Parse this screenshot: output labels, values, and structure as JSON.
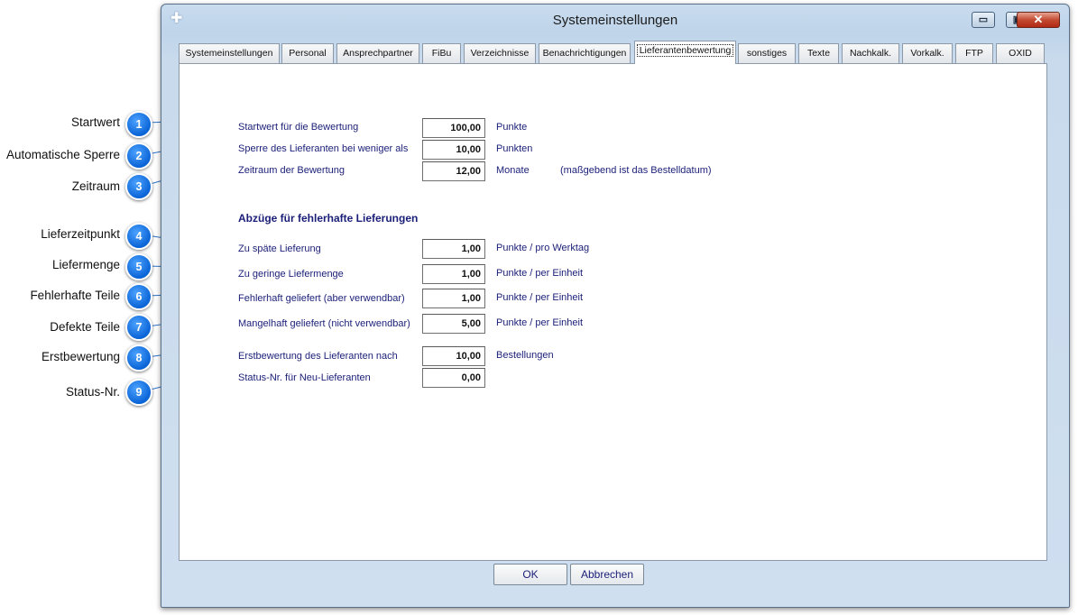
{
  "window": {
    "title": "Systemeinstellungen",
    "min_glyph": "▭",
    "max_glyph": "▣",
    "close_glyph": "✕"
  },
  "tabs": [
    {
      "label": "Systemeinstellungen"
    },
    {
      "label": "Personal"
    },
    {
      "label": "Ansprechpartner"
    },
    {
      "label": "FiBu"
    },
    {
      "label": "Verzeichnisse"
    },
    {
      "label": "Benachrichtigungen"
    },
    {
      "label": "Lieferantenbewertung",
      "active": true
    },
    {
      "label": "sonstiges"
    },
    {
      "label": "Texte"
    },
    {
      "label": "Nachkalk."
    },
    {
      "label": "Vorkalk."
    },
    {
      "label": "FTP"
    },
    {
      "label": "OXID"
    }
  ],
  "section_heading": "Abzüge für fehlerhafte Lieferungen",
  "rows": [
    {
      "label": "Startwert für die Bewertung",
      "value": "100,00",
      "unit": "Punkte"
    },
    {
      "label": "Sperre des Lieferanten bei weniger als",
      "value": "10,00",
      "unit": "Punkten"
    },
    {
      "label": "Zeitraum der Bewertung",
      "value": "12,00",
      "unit": "Monate",
      "note": "(maßgebend ist das Bestelldatum)"
    },
    {
      "label": "Zu späte Lieferung",
      "value": "1,00",
      "unit": "Punkte / pro Werktag"
    },
    {
      "label": "Zu geringe Liefermenge",
      "value": "1,00",
      "unit": "Punkte / per Einheit"
    },
    {
      "label": "Fehlerhaft geliefert (aber verwendbar)",
      "value": "1,00",
      "unit": "Punkte / per Einheit"
    },
    {
      "label": "Mangelhaft geliefert (nicht verwendbar)",
      "value": "5,00",
      "unit": "Punkte / per Einheit"
    },
    {
      "label": "Erstbewertung des Lieferanten nach",
      "value": "10,00",
      "unit": "Bestellungen"
    },
    {
      "label": "Status-Nr. für Neu-Lieferanten",
      "value": "0,00",
      "unit": ""
    }
  ],
  "callouts": [
    {
      "number": "1",
      "label": "Startwert"
    },
    {
      "number": "2",
      "label": "Automatische Sperre"
    },
    {
      "number": "3",
      "label": "Zeitraum"
    },
    {
      "number": "4",
      "label": "Lieferzeitpunkt"
    },
    {
      "number": "5",
      "label": "Liefermenge"
    },
    {
      "number": "6",
      "label": "Fehlerhafte Teile"
    },
    {
      "number": "7",
      "label": "Defekte Teile"
    },
    {
      "number": "8",
      "label": "Erstbewertung"
    },
    {
      "number": "9",
      "label": "Status-Nr."
    }
  ],
  "buttons": {
    "ok": "OK",
    "cancel": "Abbrechen"
  },
  "colors": {
    "label_text": "#1a1e78",
    "badge": "#0a64d6",
    "close_button": "#c44a32"
  }
}
